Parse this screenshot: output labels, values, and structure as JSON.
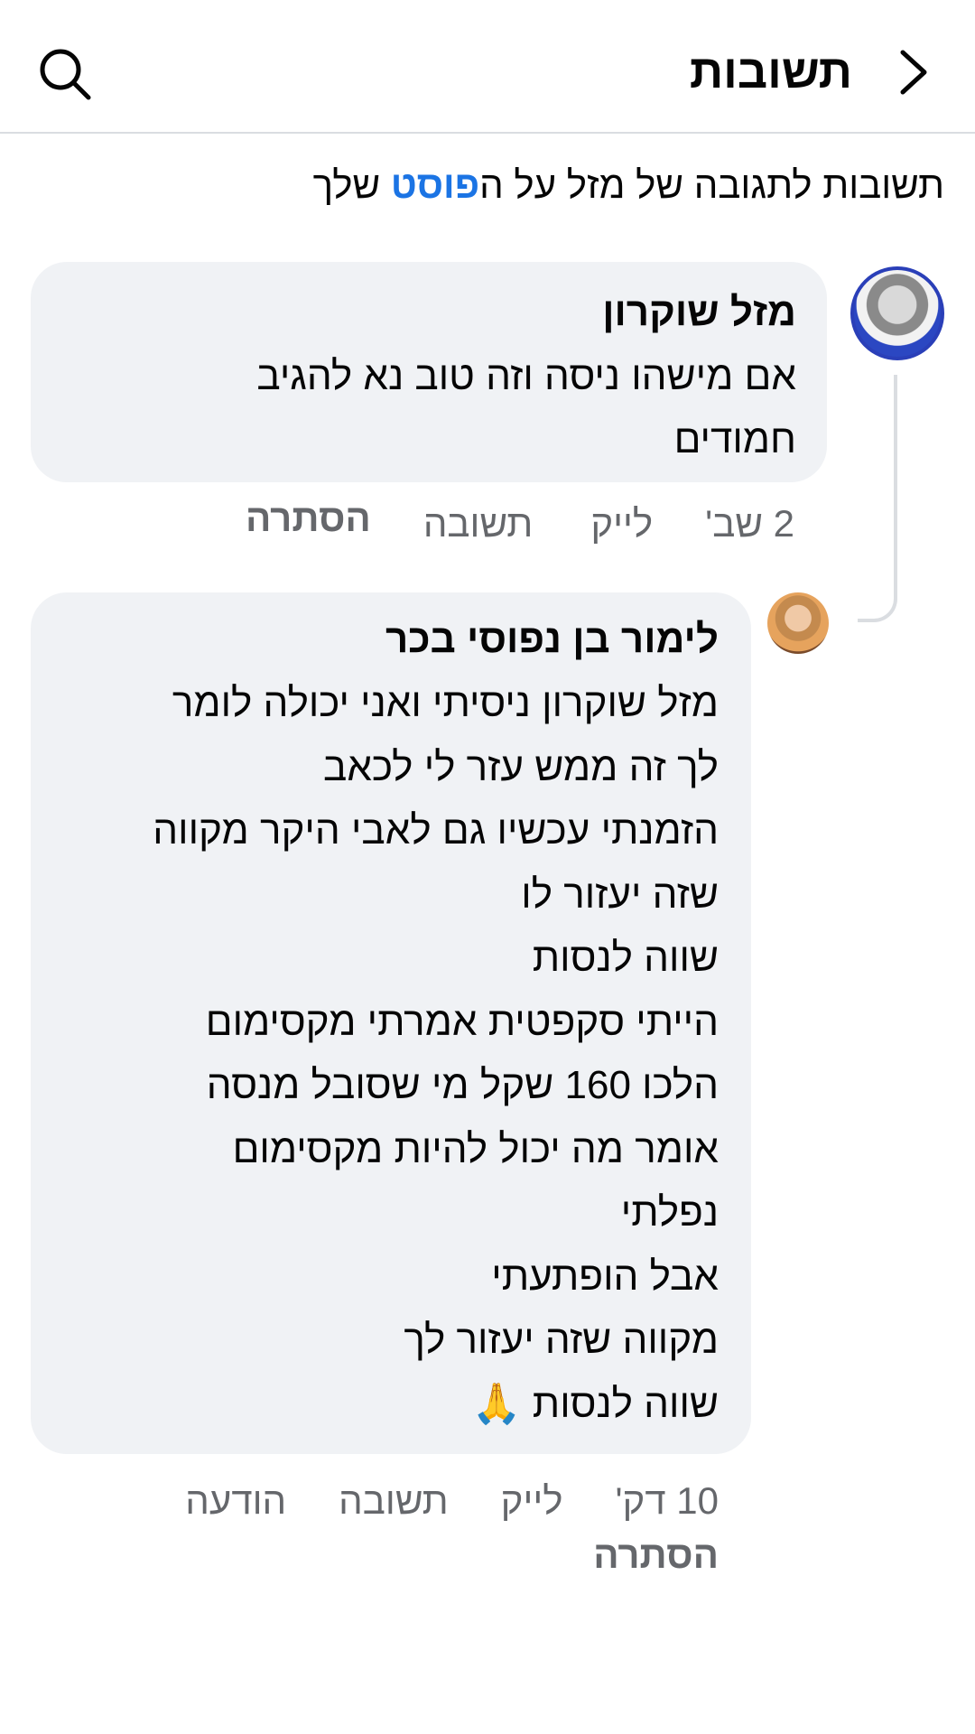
{
  "header": {
    "title": "תשובות",
    "back_icon": "chevron-right-icon",
    "search_icon": "search-icon"
  },
  "context": {
    "prefix": "תשובות לתגובה של מזל על ה",
    "link_text": "פוסט",
    "suffix": " שלך"
  },
  "comments": [
    {
      "author": "מזל שוקרון",
      "text": "אם מישהו ניסה וזה טוב נא להגיב\nחמודים",
      "time": "2 שב'",
      "like_label": "לייק",
      "reply_label": "תשובה",
      "hide_label": "הסתרה"
    },
    {
      "author": "לימור בן נפוסי בכר",
      "text": "מזל שוקרון ניסיתי ואני יכולה לומר\nלך זה ממש עזר לי לכאב\nהזמנתי עכשיו גם לאבי היקר מקווה\nשזה יעזור לו\nשווה לנסות\nהייתי סקפטית אמרתי מקסימום\nהלכו 160 שקל מי שסובל מנסה\nאומר מה יכול להיות מקסימום\nנפלתי\nאבל הופתעתי\nמקווה שזה יעזור לך\nשווה לנסות 🙏",
      "time": "10 דק'",
      "like_label": "לייק",
      "reply_label": "תשובה",
      "report_label": "הודעה",
      "hide_label": "הסתרה"
    }
  ],
  "colors": {
    "link": "#1b74e4",
    "bubble": "#f0f2f5",
    "secondary_text": "#65676b",
    "divider": "#dadde1"
  }
}
